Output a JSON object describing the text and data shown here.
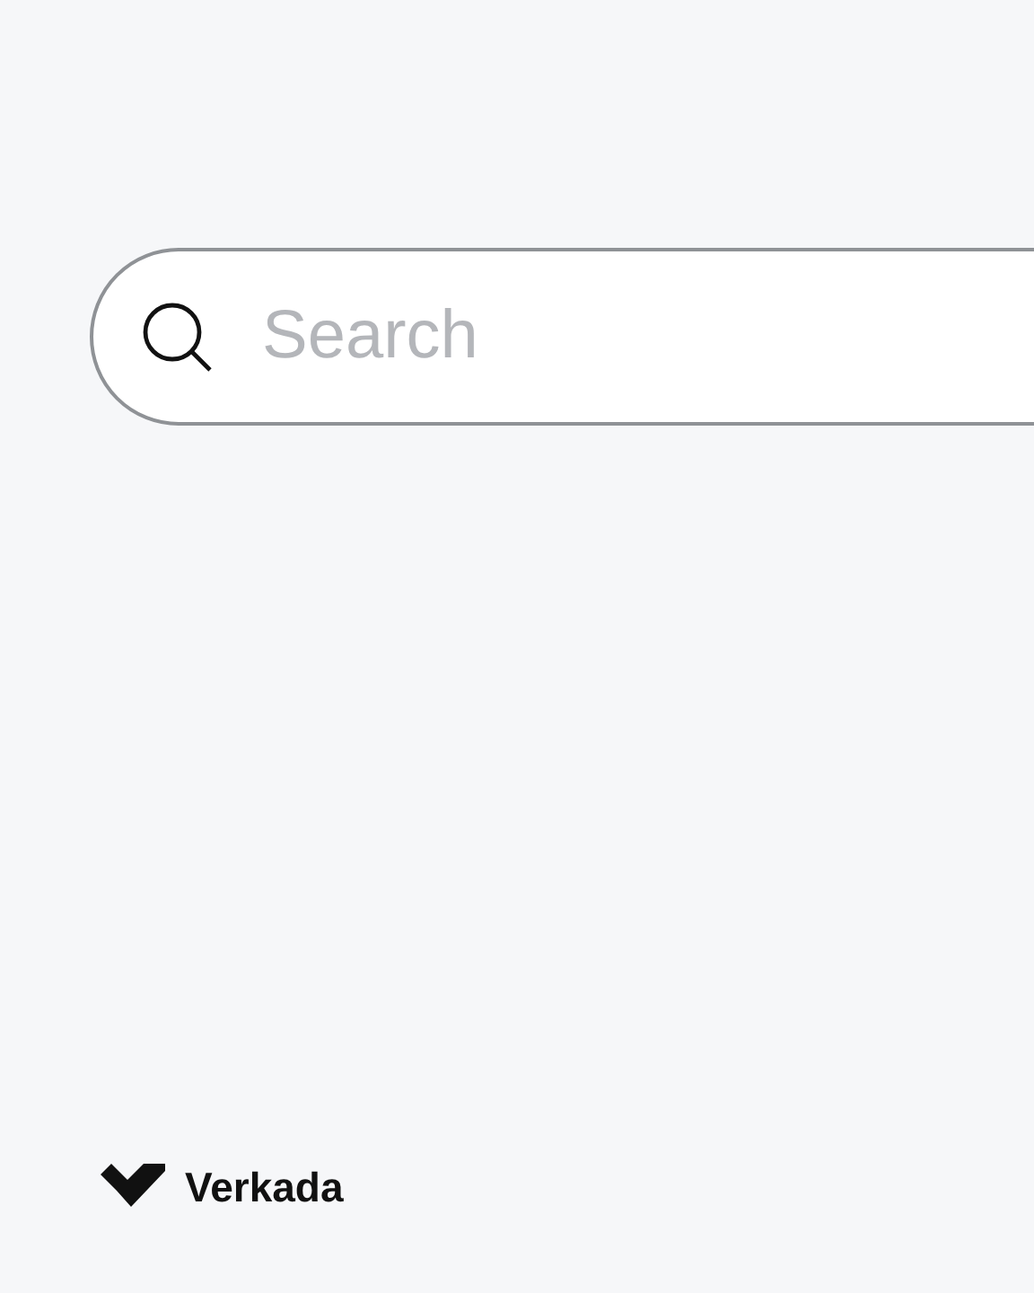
{
  "search": {
    "placeholder": "Search"
  },
  "brand": {
    "name": "Verkada"
  }
}
